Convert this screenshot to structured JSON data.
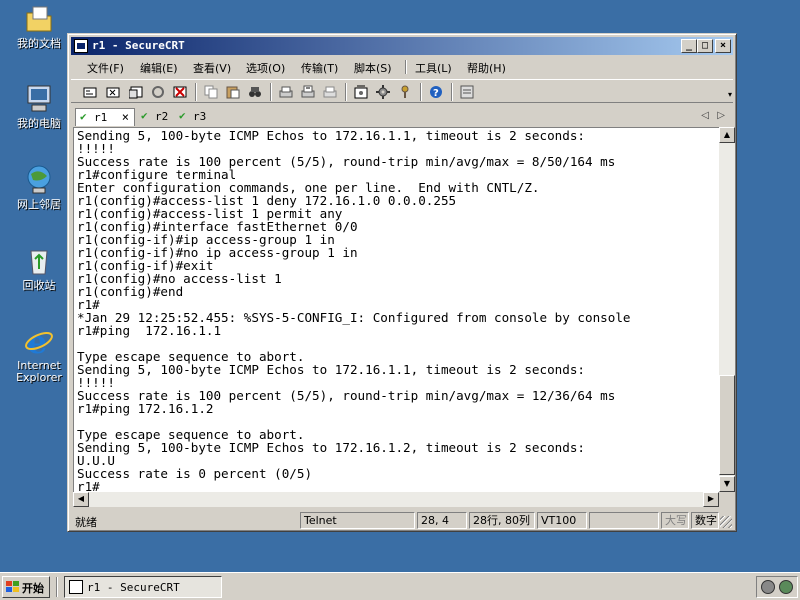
{
  "desktop": {
    "icons": [
      {
        "label": "我的文档",
        "icon": "my-documents-icon"
      },
      {
        "label": "我的电脑",
        "icon": "my-computer-icon"
      },
      {
        "label": "网上邻居",
        "icon": "network-places-icon"
      },
      {
        "label": "回收站",
        "icon": "recycle-bin-icon"
      },
      {
        "label_line1": "Internet",
        "label_line2": "Explorer",
        "icon": "internet-explorer-icon"
      }
    ]
  },
  "window": {
    "title": "r1 - SecureCRT",
    "controls": {
      "minimize": "_",
      "maximize": "□",
      "close": "×"
    }
  },
  "menu": {
    "items": [
      "文件(F)",
      "编辑(E)",
      "查看(V)",
      "选项(O)",
      "传输(T)",
      "脚本(S)",
      "工具(L)",
      "帮助(H)"
    ]
  },
  "tabs": {
    "items": [
      {
        "label": "r1",
        "status": "connected",
        "active": true,
        "close": "×"
      },
      {
        "label": "r2",
        "status": "connected",
        "active": false
      },
      {
        "label": "r3",
        "status": "connected",
        "active": false
      }
    ],
    "nav_left": "◁",
    "nav_right": "▷"
  },
  "terminal": {
    "lines": [
      "Sending 5, 100-byte ICMP Echos to 172.16.1.1, timeout is 2 seconds:",
      "!!!!!",
      "Success rate is 100 percent (5/5), round-trip min/avg/max = 8/50/164 ms",
      "r1#configure terminal",
      "Enter configuration commands, one per line.  End with CNTL/Z.",
      "r1(config)#access-list 1 deny 172.16.1.0 0.0.0.255",
      "r1(config)#access-list 1 permit any",
      "r1(config)#interface fastEthernet 0/0",
      "r1(config-if)#ip access-group 1 in",
      "r1(config-if)#no ip access-group 1 in",
      "r1(config-if)#exit",
      "r1(config)#no access-list 1",
      "r1(config)#end",
      "r1#",
      "*Jan 29 12:25:52.455: %SYS-5-CONFIG_I: Configured from console by console",
      "r1#ping  172.16.1.1",
      "",
      "Type escape sequence to abort.",
      "Sending 5, 100-byte ICMP Echos to 172.16.1.1, timeout is 2 seconds:",
      "!!!!!",
      "Success rate is 100 percent (5/5), round-trip min/avg/max = 12/36/64 ms",
      "r1#ping 172.16.1.2",
      "",
      "Type escape sequence to abort.",
      "Sending 5, 100-byte ICMP Echos to 172.16.1.2, timeout is 2 seconds:",
      "U.U.U",
      "Success rate is 0 percent (0/5)",
      "r1#"
    ]
  },
  "statusbar": {
    "ready": "就绪",
    "protocol": "Telnet",
    "cursor": "28,  4",
    "size": "28行, 80列",
    "emulation": "VT100",
    "caps": "大写",
    "num": "数字"
  },
  "taskbar": {
    "start_label": "开始",
    "task_label": "r1 - SecureCRT"
  }
}
